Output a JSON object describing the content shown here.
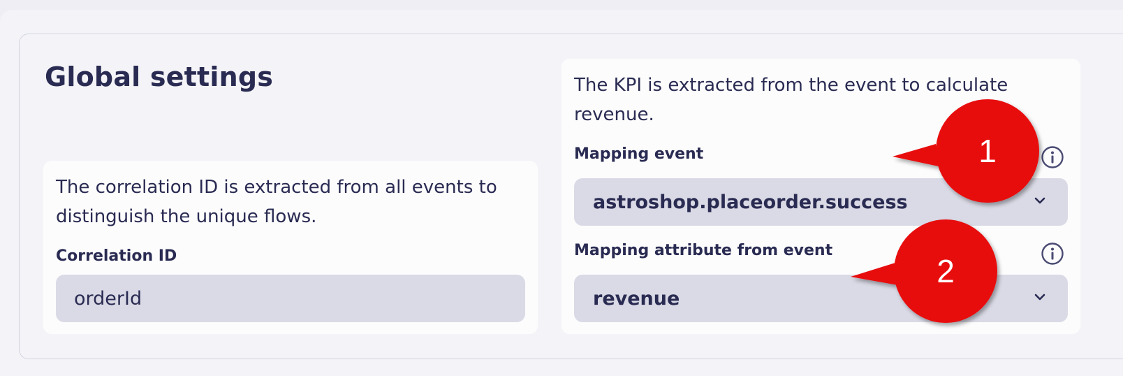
{
  "section": {
    "title": "Global settings"
  },
  "correlation": {
    "description": "The correlation ID is extracted from all events to distinguish the unique flows.",
    "field_label": "Correlation ID",
    "value": "orderId"
  },
  "kpi": {
    "description": "The KPI is extracted from the event to calculate revenue.",
    "mapping_event": {
      "label": "Mapping event",
      "value": "astroshop.placeorder.success",
      "info_icon": "info-icon"
    },
    "mapping_attribute": {
      "label": "Mapping attribute from event",
      "value": "revenue",
      "info_icon": "info-icon"
    }
  },
  "callouts": [
    {
      "number": "1",
      "color": "#e8090b"
    },
    {
      "number": "2",
      "color": "#e8090b"
    }
  ],
  "colors": {
    "text": "#2a2b52",
    "input_bg": "#dadae6",
    "panel_bg": "#fcfcfd",
    "page_bg": "#f4f4f8"
  }
}
